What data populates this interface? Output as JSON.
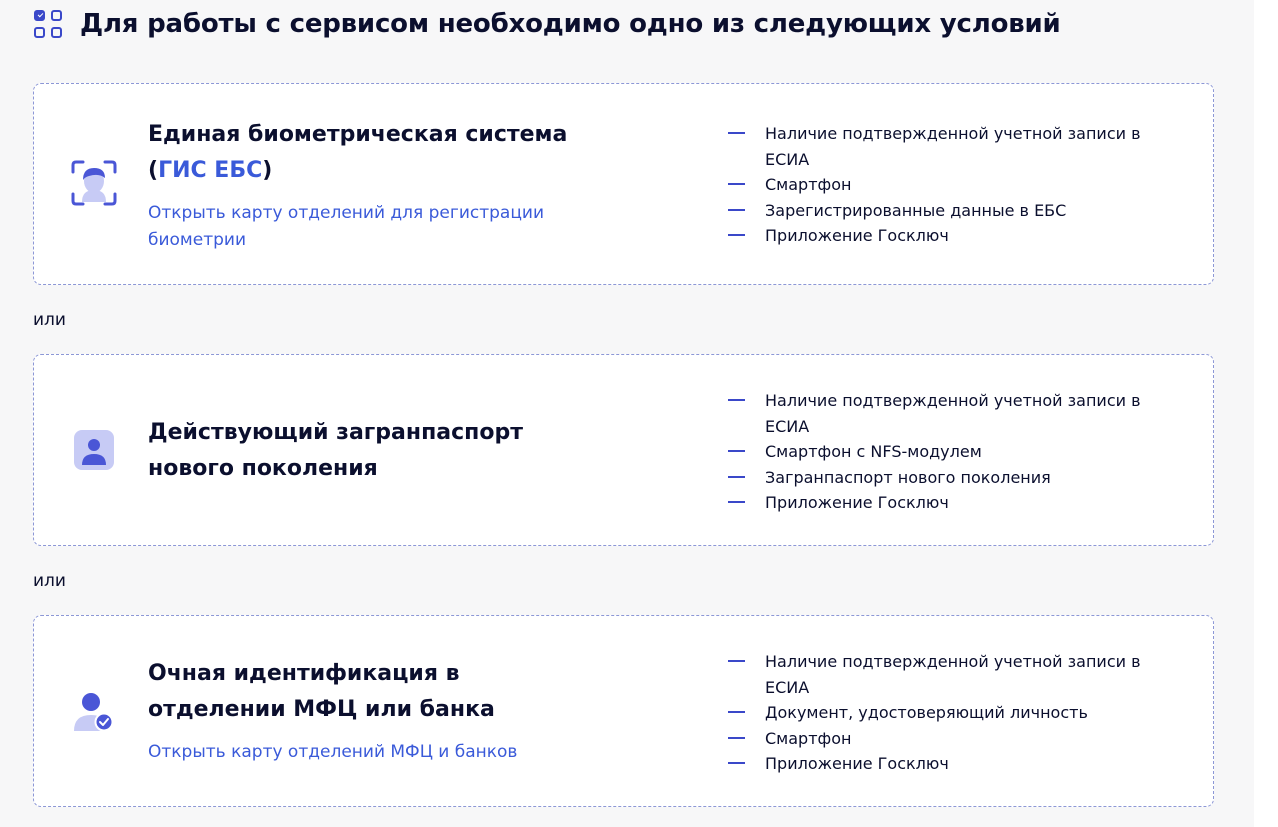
{
  "header": {
    "title": "Для работы с сервисом необходимо одно из следующих условий",
    "icon": "checklist-grid-icon"
  },
  "colors": {
    "accent": "#3a5ad9",
    "icon_blue": "#3a48c9",
    "text": "#0b0f2e",
    "card_border": "#8c97d6",
    "page_background": "#f7f7f8"
  },
  "separator": "или",
  "options": [
    {
      "icon": "face-scan-icon",
      "title_prefix": "Единая биометрическая система (",
      "title_accent": "ГИС ЕБС",
      "title_suffix": ")",
      "link": "Открыть карту отделений для регистрации биометрии",
      "requirements": [
        "Наличие подтвержденной учетной записи в ЕСИА",
        "Смартфон",
        "Зарегистрированные данные в ЕБС",
        "Приложение Госключ"
      ]
    },
    {
      "icon": "passport-user-icon",
      "title": "Действующий загранпаспорт нового поколения",
      "requirements": [
        "Наличие подтвержденной учетной записи в ЕСИА",
        "Смартфон с NFS-модулем",
        "Загранпаспорт нового поколения",
        "Приложение Госключ"
      ]
    },
    {
      "icon": "verified-user-icon",
      "title": "Очная идентификация в отделении МФЦ или банка",
      "link": "Открыть карту отделений МФЦ и банков",
      "requirements": [
        "Наличие подтвержденной учетной записи в ЕСИА",
        "Документ, удостоверяющий личность",
        "Смартфон",
        "Приложение Госключ"
      ]
    }
  ]
}
